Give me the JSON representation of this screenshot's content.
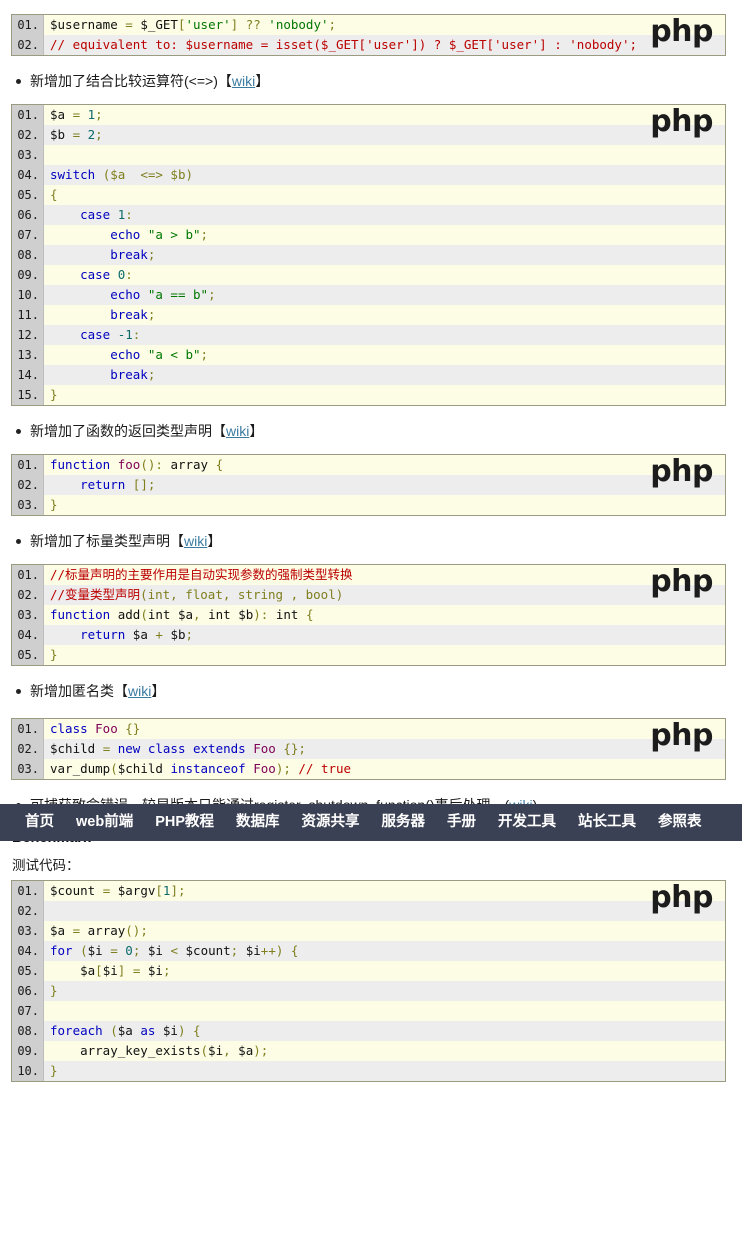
{
  "page": {
    "language": "zh-CN",
    "watermark_label": "php"
  },
  "navbar": {
    "background": "#3b4154",
    "text_color": "#ffffff",
    "items": [
      {
        "label": "首页"
      },
      {
        "label": "web前端"
      },
      {
        "label": "PHP教程"
      },
      {
        "label": "数据库"
      },
      {
        "label": "资源共享"
      },
      {
        "label": "服务器"
      },
      {
        "label": "手册"
      },
      {
        "label": "开发工具"
      },
      {
        "label": "站长工具"
      },
      {
        "label": "参照表"
      }
    ]
  },
  "sections": {
    "bullet_null_coalesce_followup": {
      "prefix": "新增加了结合比较运算符(<=>)",
      "bracket_open": "【",
      "link": "wiki",
      "bracket_close": "】"
    },
    "bullet_return_type": {
      "prefix": "新增加了函数的返回类型声明",
      "bracket_open": "【",
      "link": "wiki",
      "bracket_close": "】"
    },
    "bullet_scalar_type": {
      "prefix": "新增加了标量类型声明",
      "bracket_open": "【",
      "link": "wiki",
      "bracket_close": "】"
    },
    "bullet_anonymous_class": {
      "prefix": "新增加匿名类",
      "bracket_open": "【",
      "link": "wiki",
      "bracket_close": "】"
    },
    "bullet_catchable_error": {
      "prefix": "可捕获致命错误，较早版本只能通过register_shutdown_function()事后处理。",
      "bracket_open": "(",
      "link": "wiki",
      "bracket_close": ")"
    },
    "benchmark": {
      "heading": "Benchmark",
      "subheading": "测试代码："
    }
  },
  "code_blocks": [
    {
      "id": "null-coalescing",
      "language": "php",
      "lines": [
        {
          "n": "01.",
          "tokens": [
            {
              "t": "$username ",
              "c": "t-var"
            },
            {
              "t": "= ",
              "c": "t-pun"
            },
            {
              "t": "$_GET",
              "c": "t-var"
            },
            {
              "t": "[",
              "c": "t-pun"
            },
            {
              "t": "'user'",
              "c": "t-str"
            },
            {
              "t": "] ",
              "c": "t-pun"
            },
            {
              "t": "?? ",
              "c": "t-pun"
            },
            {
              "t": "'nobody'",
              "c": "t-str"
            },
            {
              "t": ";",
              "c": "t-pun"
            }
          ]
        },
        {
          "n": "02.",
          "tokens": [
            {
              "t": "// equivalent to: $username = isset($_GET['user']) ? $_GET['user'] : 'nobody';",
              "c": "t-com"
            }
          ]
        }
      ]
    },
    {
      "id": "spaceship-switch",
      "language": "php",
      "lines": [
        {
          "n": "01.",
          "tokens": [
            {
              "t": "$a ",
              "c": "t-var"
            },
            {
              "t": "= ",
              "c": "t-pun"
            },
            {
              "t": "1",
              "c": "t-num"
            },
            {
              "t": ";",
              "c": "t-pun"
            }
          ]
        },
        {
          "n": "02.",
          "tokens": [
            {
              "t": "$b ",
              "c": "t-var"
            },
            {
              "t": "= ",
              "c": "t-pun"
            },
            {
              "t": "2",
              "c": "t-num"
            },
            {
              "t": ";",
              "c": "t-pun"
            }
          ]
        },
        {
          "n": "03.",
          "tokens": [
            {
              "t": "",
              "c": "t-plain"
            }
          ]
        },
        {
          "n": "04.",
          "tokens": [
            {
              "t": "switch ",
              "c": "t-kw"
            },
            {
              "t": "($a  <=> $b)",
              "c": "t-pun"
            }
          ]
        },
        {
          "n": "05.",
          "tokens": [
            {
              "t": "{",
              "c": "t-pun"
            }
          ]
        },
        {
          "n": "06.",
          "tokens": [
            {
              "t": "    case ",
              "c": "t-kw"
            },
            {
              "t": "1",
              "c": "t-num"
            },
            {
              "t": ":",
              "c": "t-pun"
            }
          ]
        },
        {
          "n": "07.",
          "tokens": [
            {
              "t": "        echo ",
              "c": "t-kw"
            },
            {
              "t": "\"a > b\"",
              "c": "t-str"
            },
            {
              "t": ";",
              "c": "t-pun"
            }
          ]
        },
        {
          "n": "08.",
          "tokens": [
            {
              "t": "        break",
              "c": "t-kw"
            },
            {
              "t": ";",
              "c": "t-pun"
            }
          ]
        },
        {
          "n": "09.",
          "tokens": [
            {
              "t": "    case ",
              "c": "t-kw"
            },
            {
              "t": "0",
              "c": "t-num"
            },
            {
              "t": ":",
              "c": "t-pun"
            }
          ]
        },
        {
          "n": "10.",
          "tokens": [
            {
              "t": "        echo ",
              "c": "t-kw"
            },
            {
              "t": "\"a == b\"",
              "c": "t-str"
            },
            {
              "t": ";",
              "c": "t-pun"
            }
          ]
        },
        {
          "n": "11.",
          "tokens": [
            {
              "t": "        break",
              "c": "t-kw"
            },
            {
              "t": ";",
              "c": "t-pun"
            }
          ]
        },
        {
          "n": "12.",
          "tokens": [
            {
              "t": "    case ",
              "c": "t-kw"
            },
            {
              "t": "-1",
              "c": "t-num"
            },
            {
              "t": ":",
              "c": "t-pun"
            }
          ]
        },
        {
          "n": "13.",
          "tokens": [
            {
              "t": "        echo ",
              "c": "t-kw"
            },
            {
              "t": "\"a < b\"",
              "c": "t-str"
            },
            {
              "t": ";",
              "c": "t-pun"
            }
          ]
        },
        {
          "n": "14.",
          "tokens": [
            {
              "t": "        break",
              "c": "t-kw"
            },
            {
              "t": ";",
              "c": "t-pun"
            }
          ]
        },
        {
          "n": "15.",
          "tokens": [
            {
              "t": "}",
              "c": "t-pun"
            }
          ]
        }
      ]
    },
    {
      "id": "return-type-declaration",
      "language": "php",
      "lines": [
        {
          "n": "01.",
          "tokens": [
            {
              "t": "function ",
              "c": "t-kw"
            },
            {
              "t": "foo",
              "c": "t-fn"
            },
            {
              "t": "()",
              "c": "t-pun"
            },
            {
              "t": ": ",
              "c": "t-pun"
            },
            {
              "t": "array ",
              "c": "t-plain"
            },
            {
              "t": "{",
              "c": "t-pun"
            }
          ]
        },
        {
          "n": "02.",
          "tokens": [
            {
              "t": "    return ",
              "c": "t-kw"
            },
            {
              "t": "[];",
              "c": "t-pun"
            }
          ]
        },
        {
          "n": "03.",
          "tokens": [
            {
              "t": "}",
              "c": "t-pun"
            }
          ]
        }
      ]
    },
    {
      "id": "scalar-type-declaration",
      "language": "php",
      "lines": [
        {
          "n": "01.",
          "tokens": [
            {
              "t": "//标量声明的主要作用是自动实现参数的强制类型转换",
              "c": "t-com"
            }
          ]
        },
        {
          "n": "02.",
          "tokens": [
            {
              "t": "//变量类型声明",
              "c": "t-com"
            },
            {
              "t": "(int, float, string , bool)",
              "c": "t-pun"
            }
          ]
        },
        {
          "n": "03.",
          "tokens": [
            {
              "t": "function ",
              "c": "t-kw"
            },
            {
              "t": "add",
              "c": "t-plain"
            },
            {
              "t": "(",
              "c": "t-pun"
            },
            {
              "t": "int ",
              "c": "t-plain"
            },
            {
              "t": "$a",
              "c": "t-var"
            },
            {
              "t": ", ",
              "c": "t-pun"
            },
            {
              "t": "int ",
              "c": "t-plain"
            },
            {
              "t": "$b",
              "c": "t-var"
            },
            {
              "t": ")",
              "c": "t-pun"
            },
            {
              "t": ": ",
              "c": "t-pun"
            },
            {
              "t": "int ",
              "c": "t-plain"
            },
            {
              "t": "{",
              "c": "t-pun"
            }
          ]
        },
        {
          "n": "04.",
          "tokens": [
            {
              "t": "    return ",
              "c": "t-kw"
            },
            {
              "t": "$a ",
              "c": "t-var"
            },
            {
              "t": "+ ",
              "c": "t-pun"
            },
            {
              "t": "$b",
              "c": "t-var"
            },
            {
              "t": ";",
              "c": "t-pun"
            }
          ]
        },
        {
          "n": "05.",
          "tokens": [
            {
              "t": "}",
              "c": "t-pun"
            }
          ]
        }
      ]
    },
    {
      "id": "anonymous-class",
      "language": "php",
      "lines": [
        {
          "n": "01.",
          "tokens": [
            {
              "t": "class ",
              "c": "t-kw"
            },
            {
              "t": "Foo ",
              "c": "t-cls"
            },
            {
              "t": "{}",
              "c": "t-pun"
            }
          ]
        },
        {
          "n": "02.",
          "tokens": [
            {
              "t": "$child ",
              "c": "t-var"
            },
            {
              "t": "= ",
              "c": "t-pun"
            },
            {
              "t": "new class extends ",
              "c": "t-kw"
            },
            {
              "t": "Foo ",
              "c": "t-cls"
            },
            {
              "t": "{};",
              "c": "t-pun"
            }
          ]
        },
        {
          "n": "03.",
          "tokens": [
            {
              "t": "var_dump",
              "c": "t-plain"
            },
            {
              "t": "(",
              "c": "t-pun"
            },
            {
              "t": "$child ",
              "c": "t-var"
            },
            {
              "t": "instanceof ",
              "c": "t-kw"
            },
            {
              "t": "Foo",
              "c": "t-cls"
            },
            {
              "t": "); ",
              "c": "t-pun"
            },
            {
              "t": "// true",
              "c": "t-com"
            }
          ]
        }
      ]
    },
    {
      "id": "benchmark-test-code",
      "language": "php",
      "lines": [
        {
          "n": "01.",
          "tokens": [
            {
              "t": "$count ",
              "c": "t-var"
            },
            {
              "t": "= ",
              "c": "t-pun"
            },
            {
              "t": "$argv",
              "c": "t-var"
            },
            {
              "t": "[",
              "c": "t-pun"
            },
            {
              "t": "1",
              "c": "t-num"
            },
            {
              "t": "];",
              "c": "t-pun"
            }
          ]
        },
        {
          "n": "02.",
          "tokens": [
            {
              "t": "",
              "c": "t-plain"
            }
          ]
        },
        {
          "n": "03.",
          "tokens": [
            {
              "t": "$a ",
              "c": "t-var"
            },
            {
              "t": "= ",
              "c": "t-pun"
            },
            {
              "t": "array",
              "c": "t-plain"
            },
            {
              "t": "();",
              "c": "t-pun"
            }
          ]
        },
        {
          "n": "04.",
          "tokens": [
            {
              "t": "for ",
              "c": "t-kw"
            },
            {
              "t": "(",
              "c": "t-pun"
            },
            {
              "t": "$i ",
              "c": "t-var"
            },
            {
              "t": "= ",
              "c": "t-pun"
            },
            {
              "t": "0",
              "c": "t-num"
            },
            {
              "t": "; ",
              "c": "t-pun"
            },
            {
              "t": "$i ",
              "c": "t-var"
            },
            {
              "t": "< ",
              "c": "t-pun"
            },
            {
              "t": "$count",
              "c": "t-var"
            },
            {
              "t": "; ",
              "c": "t-pun"
            },
            {
              "t": "$i",
              "c": "t-var"
            },
            {
              "t": "++) ",
              "c": "t-pun"
            },
            {
              "t": "{",
              "c": "t-pun"
            }
          ]
        },
        {
          "n": "05.",
          "tokens": [
            {
              "t": "    $a",
              "c": "t-var"
            },
            {
              "t": "[",
              "c": "t-pun"
            },
            {
              "t": "$i",
              "c": "t-var"
            },
            {
              "t": "] ",
              "c": "t-pun"
            },
            {
              "t": "= ",
              "c": "t-pun"
            },
            {
              "t": "$i",
              "c": "t-var"
            },
            {
              "t": ";",
              "c": "t-pun"
            }
          ]
        },
        {
          "n": "06.",
          "tokens": [
            {
              "t": "}",
              "c": "t-pun"
            }
          ]
        },
        {
          "n": "07.",
          "tokens": [
            {
              "t": "",
              "c": "t-plain"
            }
          ]
        },
        {
          "n": "08.",
          "tokens": [
            {
              "t": "foreach ",
              "c": "t-kw"
            },
            {
              "t": "(",
              "c": "t-pun"
            },
            {
              "t": "$a ",
              "c": "t-var"
            },
            {
              "t": "as ",
              "c": "t-kw"
            },
            {
              "t": "$i",
              "c": "t-var"
            },
            {
              "t": ") ",
              "c": "t-pun"
            },
            {
              "t": "{",
              "c": "t-pun"
            }
          ]
        },
        {
          "n": "09.",
          "tokens": [
            {
              "t": "    array_key_exists",
              "c": "t-plain"
            },
            {
              "t": "(",
              "c": "t-pun"
            },
            {
              "t": "$i",
              "c": "t-var"
            },
            {
              "t": ", ",
              "c": "t-pun"
            },
            {
              "t": "$a",
              "c": "t-var"
            },
            {
              "t": ");",
              "c": "t-pun"
            }
          ]
        },
        {
          "n": "10.",
          "tokens": [
            {
              "t": "}",
              "c": "t-pun"
            }
          ]
        }
      ]
    }
  ]
}
